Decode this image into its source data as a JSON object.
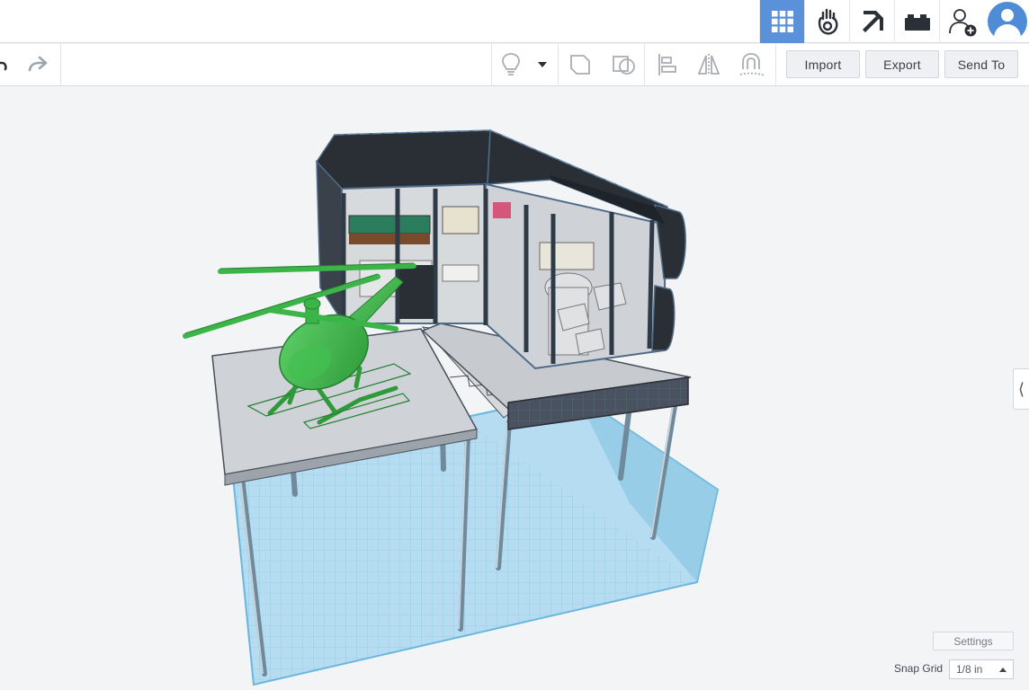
{
  "header": {
    "modes": [
      {
        "icon": "grid-view-icon",
        "active": true
      },
      {
        "icon": "codeblocks-hand-icon",
        "active": false
      },
      {
        "icon": "minecraft-pickaxe-icon",
        "active": false
      },
      {
        "icon": "brick-icon",
        "active": false
      },
      {
        "icon": "add-user-icon",
        "active": false
      }
    ],
    "avatar_icon": "user-avatar-icon"
  },
  "toolbar": {
    "undo_icon": "undo-icon",
    "redo_icon": "redo-icon",
    "tools": [
      "lightbulb-icon",
      "dropdown-caret-icon",
      "group-icon",
      "ungroup-icon",
      "align-icon",
      "mirror-icon",
      "cruise-magnet-icon"
    ],
    "import_label": "Import",
    "export_label": "Export",
    "send_to_label": "Send To"
  },
  "workplane": {
    "settings_label": "Settings",
    "snap_grid_label": "Snap Grid",
    "snap_grid_value": "1/8 in",
    "side_panel_toggle": "⟨",
    "colors": {
      "background": "#f3f4f6",
      "accent": "#5b91d9",
      "helicopter": "#3cb548",
      "water": "#7ec3e8",
      "building_dark": "#2a2e35"
    }
  }
}
